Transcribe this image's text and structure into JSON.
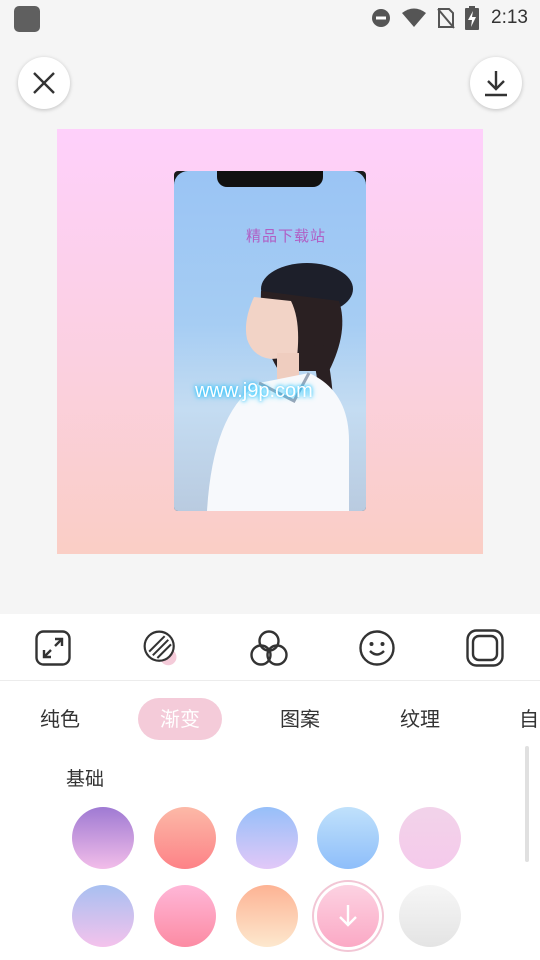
{
  "status_bar": {
    "time": "2:13",
    "icons": [
      "app-icon",
      "do-not-disturb-icon",
      "wifi-icon",
      "no-sim-icon",
      "battery-charging-icon"
    ]
  },
  "toolbar": {
    "close_icon": "close-icon",
    "download_icon": "download-icon"
  },
  "preview": {
    "watermark_top": "精品下载站",
    "watermark_url": "www.j9p.com"
  },
  "tools": [
    {
      "icon": "resize-icon",
      "active": false
    },
    {
      "icon": "gradient-stripes-icon",
      "active": true
    },
    {
      "icon": "filter-circles-icon",
      "active": false
    },
    {
      "icon": "sticker-smiley-icon",
      "active": false
    },
    {
      "icon": "frame-icon",
      "active": false
    }
  ],
  "tabs": [
    {
      "label": "纯色",
      "active": false
    },
    {
      "label": "渐变",
      "active": true
    },
    {
      "label": "图案",
      "active": false
    },
    {
      "label": "纹理",
      "active": false
    },
    {
      "label": "自",
      "active": false
    }
  ],
  "section": {
    "label": "基础"
  },
  "swatches": [
    {
      "from": "#9f7ad3",
      "to": "#f2bde9"
    },
    {
      "from": "#fcb9a7",
      "to": "#fd8287"
    },
    {
      "from": "#96bff9",
      "to": "#e2c8f8"
    },
    {
      "from": "#c0e1fb",
      "to": "#8ebefa"
    },
    {
      "from": "#f2d3ea",
      "to": "#f5caeb"
    },
    {
      "from": "#a8c0f1",
      "to": "#f4c2ec"
    },
    {
      "from": "#ffb7d8",
      "to": "#fc8ba3"
    },
    {
      "from": "#fdb394",
      "to": "#fde8ce"
    },
    {
      "from": "#fcd2e2",
      "to": "#fba9c5",
      "selected": true
    },
    {
      "from": "#f6f6f6",
      "to": "#e4e4e4"
    }
  ],
  "colors": {
    "accent_pink": "#f4cbd9",
    "canvas_top": "#fed0fb",
    "canvas_bottom": "#facec5"
  }
}
